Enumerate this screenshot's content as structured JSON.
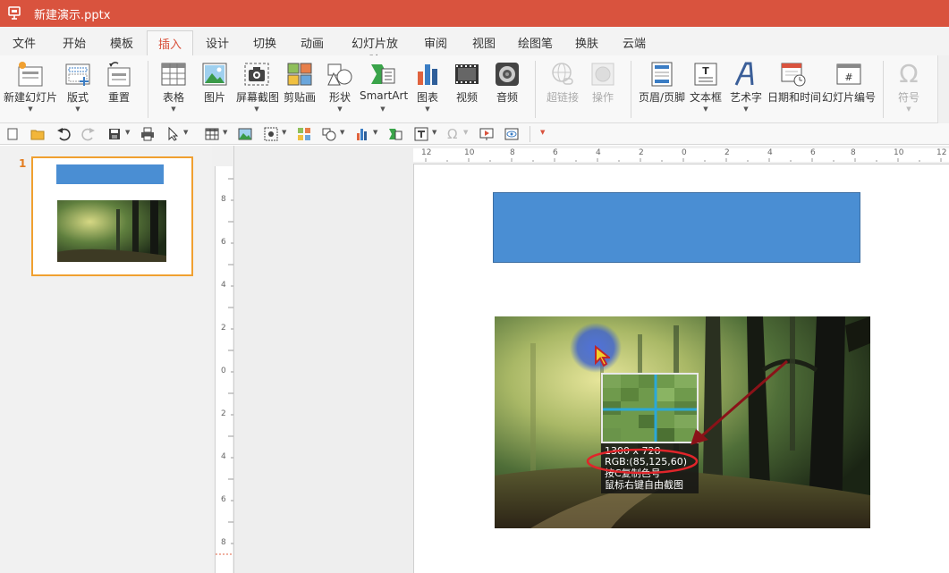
{
  "window": {
    "title": "新建演示.pptx"
  },
  "tabs": [
    {
      "label": "文件",
      "active": false
    },
    {
      "label": "开始",
      "active": false
    },
    {
      "label": "模板",
      "active": false
    },
    {
      "label": "插入",
      "active": true
    },
    {
      "label": "设计",
      "active": false
    },
    {
      "label": "切换",
      "active": false
    },
    {
      "label": "动画",
      "active": false
    },
    {
      "label": "幻灯片放映",
      "active": false
    },
    {
      "label": "审阅",
      "active": false
    },
    {
      "label": "视图",
      "active": false
    },
    {
      "label": "绘图笔",
      "active": false
    },
    {
      "label": "换肤",
      "active": false
    },
    {
      "label": "云端",
      "active": false
    }
  ],
  "ribbon": {
    "new_slide": "新建幻灯片",
    "layout": "版式",
    "reset": "重置",
    "table": "表格",
    "picture": "图片",
    "screenshot": "屏幕截图",
    "clipart": "剪贴画",
    "shapes": "形状",
    "smartart": "SmartArt",
    "chart": "图表",
    "video": "视频",
    "audio": "音频",
    "hyperlink": "超链接",
    "action": "操作",
    "header_footer": "页眉/页脚",
    "textbox": "文本框",
    "wordart": "艺术字",
    "datetime": "日期和时间",
    "slide_number": "幻灯片编号",
    "symbol": "符号"
  },
  "thumbnails": [
    {
      "number": "1"
    }
  ],
  "ruler": {
    "horizontal": [
      "12",
      "10",
      "8",
      "6",
      "4",
      "2",
      "0",
      "2",
      "4",
      "6",
      "8",
      "10",
      "12"
    ],
    "vertical": [
      "8",
      "6",
      "4",
      "2",
      "0",
      "2",
      "4",
      "6",
      "8"
    ]
  },
  "color_picker": {
    "size": "1300 x 728",
    "rgb": "RGB:(85,125,60)",
    "hint_copy": "按C复制色号",
    "hint_capture": "鼠标右键自由截图"
  },
  "colors": {
    "accent": "#d9533e",
    "shape_fill": "#4a8ed3",
    "picked": "#557d3c"
  }
}
